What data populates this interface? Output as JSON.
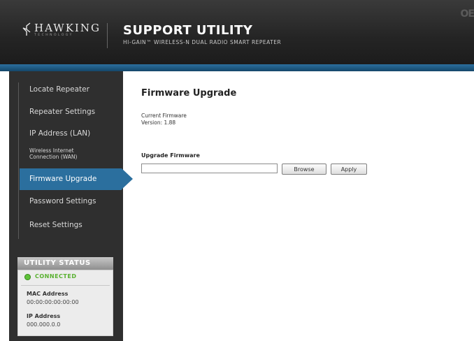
{
  "header": {
    "logo_text": "HAWKING",
    "logo_tagline": "TECHNOLOGY",
    "title": "SUPPORT UTILITY",
    "subtitle": "HI-GAIN™ WIRELESS-N DUAL RADIO SMART REPEATER",
    "corner_text": "OE"
  },
  "sidebar": {
    "items": [
      {
        "label": "Locate Repeater"
      },
      {
        "label": "Repeater Settings"
      },
      {
        "label": "IP Address (LAN)"
      },
      {
        "label": "Wireless Internet"
      },
      {
        "label": "Connection (WAN)"
      },
      {
        "label": "Firmware Upgrade"
      },
      {
        "label": "Password Settings"
      },
      {
        "label": "Reset Settings"
      }
    ],
    "active_item": "Firmware Upgrade"
  },
  "status": {
    "header": "UTILITY STATUS",
    "connection": "CONNECTED",
    "mac_label": "MAC Address",
    "mac_value": "00:00:00:00:00:00",
    "ip_label": "IP Address",
    "ip_value": "000.000.0.0",
    "connected_color": "#5fc23a"
  },
  "main": {
    "title": "Firmware Upgrade",
    "current_firmware_label": "Current Firmware",
    "version_text": "Version: 1.88",
    "upgrade_label": "Upgrade Firmware",
    "file_value": "",
    "browse_label": "Browse",
    "apply_label": "Apply"
  },
  "colors": {
    "accent": "#2b6f9e",
    "sidebar_bg": "#2f2f2f",
    "header_bg": "#242424"
  }
}
